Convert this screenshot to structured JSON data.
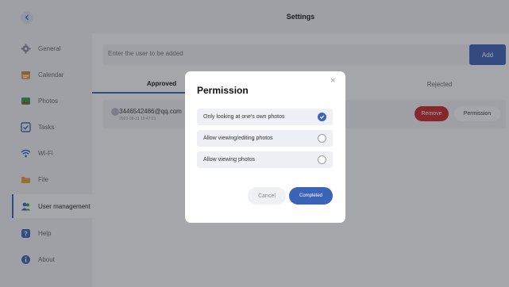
{
  "header": {
    "title": "Settings"
  },
  "sidebar": {
    "items": [
      {
        "label": "General",
        "icon": "gear-icon",
        "color": "#8a8f99"
      },
      {
        "label": "Calendar",
        "icon": "calendar-icon",
        "color": "#e6a23c"
      },
      {
        "label": "Photos",
        "icon": "photos-icon",
        "color": "#2e9e5b"
      },
      {
        "label": "Tasks",
        "icon": "tasks-icon",
        "color": "#3b63b8"
      },
      {
        "label": "Wi-Fi",
        "icon": "wifi-icon",
        "color": "#3b63b8"
      },
      {
        "label": "File",
        "icon": "folder-icon",
        "color": "#e6a23c"
      },
      {
        "label": "User management",
        "icon": "users-icon",
        "color": "#3b63b8",
        "active": true
      },
      {
        "label": "Help",
        "icon": "help-icon",
        "color": "#3b63b8"
      },
      {
        "label": "About",
        "icon": "info-icon",
        "color": "#3b63b8"
      }
    ]
  },
  "add_user": {
    "placeholder": "Enter the user to be added",
    "button_label": "Add"
  },
  "tabs": [
    {
      "label": "Approved"
    },
    {
      "label": "Rejected"
    }
  ],
  "user": {
    "email": "3446542486@qq.com",
    "timestamp": "2023-08-31 15:47:21",
    "remove_label": "Remove",
    "permission_label": "Permission"
  },
  "modal": {
    "title": "Permission",
    "close": "×",
    "options": [
      {
        "label": "Only looking at one's own photos",
        "selected": true
      },
      {
        "label": "Allow viewing/editing photos",
        "selected": false
      },
      {
        "label": "Allow viewing photos",
        "selected": false
      }
    ],
    "cancel_label": "Cancel",
    "confirm_label": "Completed"
  },
  "colors": {
    "accent": "#3b63b8",
    "danger": "#c62626"
  }
}
